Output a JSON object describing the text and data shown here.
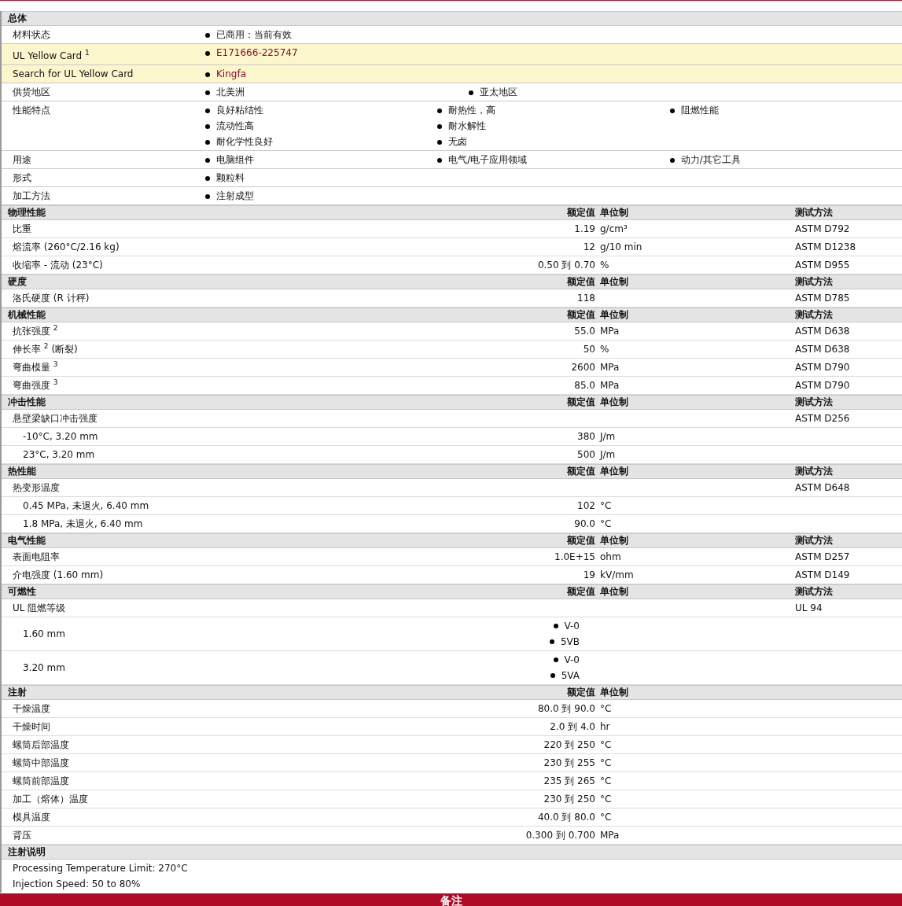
{
  "general": {
    "title": "总体",
    "rows": [
      {
        "kind": "text",
        "label": "材料状态",
        "columns": [
          [
            "已商用：当前有效"
          ]
        ]
      },
      {
        "kind": "link",
        "label": "UL Yellow Card $^{1}$",
        "columns": [
          [
            "E171666-225747"
          ]
        ]
      },
      {
        "kind": "link",
        "label": "Search for UL Yellow Card",
        "columns": [
          [
            "Kingfa"
          ]
        ]
      },
      {
        "kind": "text",
        "label": "供货地区",
        "columns": [
          [
            "北美洲"
          ],
          [
            "亚太地区"
          ]
        ]
      },
      {
        "kind": "text",
        "label": "性能特点",
        "columns": [
          [
            "良好粘结性",
            "流动性高",
            "耐化学性良好"
          ],
          [
            "耐热性，高",
            "耐水解性",
            "无卤"
          ],
          [
            "阻燃性能"
          ]
        ]
      },
      {
        "kind": "text",
        "label": "用途",
        "columns": [
          [
            "电脑组件"
          ],
          [
            "电气/电子应用领域"
          ],
          [
            "动力/其它工具"
          ]
        ]
      },
      {
        "kind": "text",
        "label": "形式",
        "columns": [
          [
            "颗粒料"
          ]
        ]
      },
      {
        "kind": "text",
        "label": "加工方法",
        "columns": [
          [
            "注射成型"
          ]
        ]
      }
    ]
  },
  "sections": [
    {
      "title": "物理性能",
      "value_header": "额定值",
      "unit_header": "单位制",
      "method_header": "测试方法",
      "rows": [
        {
          "kind": "main",
          "label": "比重",
          "value": "1.19",
          "unit": "g/cm³",
          "method": "ASTM D792"
        },
        {
          "kind": "main",
          "label": "熔流率  (260°C/2.16 kg)",
          "value": "12",
          "unit": "g/10 min",
          "method": "ASTM D1238"
        },
        {
          "kind": "main",
          "label": "收缩率  - 流动  (23°C)",
          "value": "0.50 到  0.70",
          "unit": "%",
          "method": "ASTM D955"
        }
      ]
    },
    {
      "title": "硬度",
      "value_header": "额定值",
      "unit_header": "单位制",
      "method_header": "测试方法",
      "rows": [
        {
          "kind": "main",
          "label": "洛氏硬度  (R 计秤)",
          "value": "118",
          "method": "ASTM D785"
        }
      ]
    },
    {
      "title": "机械性能",
      "value_header": "额定值",
      "unit_header": "单位制",
      "method_header": "测试方法",
      "rows": [
        {
          "kind": "main",
          "label": "抗张强度 $^{2}$",
          "value": "55.0",
          "unit": "MPa",
          "method": "ASTM D638"
        },
        {
          "kind": "main",
          "label": "伸长率 $^{2}$ (断裂)",
          "value": "50",
          "unit": "%",
          "method": "ASTM D638"
        },
        {
          "kind": "main",
          "label": "弯曲模量 $^{3}$",
          "value": "2600",
          "unit": "MPa",
          "method": "ASTM D790"
        },
        {
          "kind": "main",
          "label": "弯曲强度 $^{3}$",
          "value": "85.0",
          "unit": "MPa",
          "method": "ASTM D790"
        }
      ]
    },
    {
      "title": "冲击性能",
      "value_header": "额定值",
      "unit_header": "单位制",
      "method_header": "测试方法",
      "rows": [
        {
          "kind": "main",
          "label": "悬壁梁缺口冲击强度",
          "method": "ASTM D256"
        },
        {
          "kind": "sub",
          "label": "-10°C, 3.20 mm",
          "value": "380",
          "unit": "J/m"
        },
        {
          "kind": "sub",
          "label": "23°C, 3.20 mm",
          "value": "500",
          "unit": "J/m"
        }
      ]
    },
    {
      "title": "热性能",
      "value_header": "额定值",
      "unit_header": "单位制",
      "method_header": "测试方法",
      "rows": [
        {
          "kind": "main",
          "label": "热变形温度",
          "method": "ASTM D648"
        },
        {
          "kind": "sub",
          "label": "0.45 MPa, 未退火, 6.40 mm",
          "value": "102",
          "unit": "°C"
        },
        {
          "kind": "sub",
          "label": "1.8 MPa, 未退火, 6.40 mm",
          "value": "90.0",
          "unit": "°C"
        }
      ]
    },
    {
      "title": "电气性能",
      "value_header": "额定值",
      "unit_header": "单位制",
      "method_header": "测试方法",
      "rows": [
        {
          "kind": "main",
          "label": "表面电阻率",
          "value": "1.0E+15",
          "unit": "ohm",
          "method": "ASTM D257"
        },
        {
          "kind": "main",
          "label": "介电强度  (1.60 mm)",
          "value": "19",
          "unit": "kV/mm",
          "method": "ASTM D149"
        }
      ]
    },
    {
      "title": "可燃性",
      "value_header": "额定值",
      "unit_header": "单位制",
      "method_header": "测试方法",
      "rows": [
        {
          "kind": "main",
          "label": "UL 阻燃等级",
          "method": "UL 94"
        },
        {
          "kind": "list",
          "label": "1.60 mm",
          "items": [
            "V-0",
            "5VB"
          ]
        },
        {
          "kind": "list",
          "label": "3.20 mm",
          "items": [
            "V-0",
            "5VA"
          ]
        }
      ]
    },
    {
      "title": "注射",
      "value_header": "额定值",
      "unit_header": "单位制",
      "rows": [
        {
          "kind": "main",
          "label": "干燥温度",
          "value": "80.0 到  90.0",
          "unit": "°C"
        },
        {
          "kind": "main",
          "label": "干燥时间",
          "value": "2.0 到  4.0",
          "unit": "hr"
        },
        {
          "kind": "main",
          "label": "螺筒后部温度",
          "value": "220 到  250",
          "unit": "°C"
        },
        {
          "kind": "main",
          "label": "螺筒中部温度",
          "value": "230 到  255",
          "unit": "°C"
        },
        {
          "kind": "main",
          "label": "螺筒前部温度",
          "value": "235 到  265",
          "unit": "°C"
        },
        {
          "kind": "main",
          "label": "加工（熔体）温度",
          "value": "230 到  250",
          "unit": "°C"
        },
        {
          "kind": "main",
          "label": "模具温度",
          "value": "40.0 到  80.0",
          "unit": "°C"
        },
        {
          "kind": "main",
          "label": "背压",
          "value": "0.300 到  0.700",
          "unit": "MPa"
        }
      ]
    }
  ],
  "notes": {
    "title": "注射说明",
    "lines": [
      "Processing Temperature Limit: 270°C",
      "Injection Speed: 50 to 80%"
    ]
  },
  "footer": {
    "title": "备注"
  }
}
